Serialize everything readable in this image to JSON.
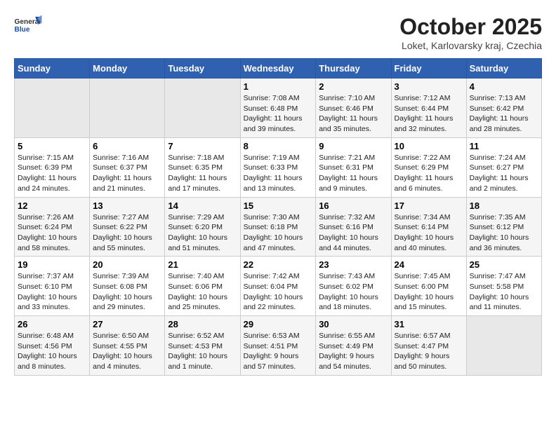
{
  "header": {
    "logo_general": "General",
    "logo_blue": "Blue",
    "title": "October 2025",
    "location": "Loket, Karlovarsky kraj, Czechia"
  },
  "weekdays": [
    "Sunday",
    "Monday",
    "Tuesday",
    "Wednesday",
    "Thursday",
    "Friday",
    "Saturday"
  ],
  "weeks": [
    [
      {
        "day": "",
        "info": ""
      },
      {
        "day": "",
        "info": ""
      },
      {
        "day": "",
        "info": ""
      },
      {
        "day": "1",
        "info": "Sunrise: 7:08 AM\nSunset: 6:48 PM\nDaylight: 11 hours and 39 minutes."
      },
      {
        "day": "2",
        "info": "Sunrise: 7:10 AM\nSunset: 6:46 PM\nDaylight: 11 hours and 35 minutes."
      },
      {
        "day": "3",
        "info": "Sunrise: 7:12 AM\nSunset: 6:44 PM\nDaylight: 11 hours and 32 minutes."
      },
      {
        "day": "4",
        "info": "Sunrise: 7:13 AM\nSunset: 6:42 PM\nDaylight: 11 hours and 28 minutes."
      }
    ],
    [
      {
        "day": "5",
        "info": "Sunrise: 7:15 AM\nSunset: 6:39 PM\nDaylight: 11 hours and 24 minutes."
      },
      {
        "day": "6",
        "info": "Sunrise: 7:16 AM\nSunset: 6:37 PM\nDaylight: 11 hours and 21 minutes."
      },
      {
        "day": "7",
        "info": "Sunrise: 7:18 AM\nSunset: 6:35 PM\nDaylight: 11 hours and 17 minutes."
      },
      {
        "day": "8",
        "info": "Sunrise: 7:19 AM\nSunset: 6:33 PM\nDaylight: 11 hours and 13 minutes."
      },
      {
        "day": "9",
        "info": "Sunrise: 7:21 AM\nSunset: 6:31 PM\nDaylight: 11 hours and 9 minutes."
      },
      {
        "day": "10",
        "info": "Sunrise: 7:22 AM\nSunset: 6:29 PM\nDaylight: 11 hours and 6 minutes."
      },
      {
        "day": "11",
        "info": "Sunrise: 7:24 AM\nSunset: 6:27 PM\nDaylight: 11 hours and 2 minutes."
      }
    ],
    [
      {
        "day": "12",
        "info": "Sunrise: 7:26 AM\nSunset: 6:24 PM\nDaylight: 10 hours and 58 minutes."
      },
      {
        "day": "13",
        "info": "Sunrise: 7:27 AM\nSunset: 6:22 PM\nDaylight: 10 hours and 55 minutes."
      },
      {
        "day": "14",
        "info": "Sunrise: 7:29 AM\nSunset: 6:20 PM\nDaylight: 10 hours and 51 minutes."
      },
      {
        "day": "15",
        "info": "Sunrise: 7:30 AM\nSunset: 6:18 PM\nDaylight: 10 hours and 47 minutes."
      },
      {
        "day": "16",
        "info": "Sunrise: 7:32 AM\nSunset: 6:16 PM\nDaylight: 10 hours and 44 minutes."
      },
      {
        "day": "17",
        "info": "Sunrise: 7:34 AM\nSunset: 6:14 PM\nDaylight: 10 hours and 40 minutes."
      },
      {
        "day": "18",
        "info": "Sunrise: 7:35 AM\nSunset: 6:12 PM\nDaylight: 10 hours and 36 minutes."
      }
    ],
    [
      {
        "day": "19",
        "info": "Sunrise: 7:37 AM\nSunset: 6:10 PM\nDaylight: 10 hours and 33 minutes."
      },
      {
        "day": "20",
        "info": "Sunrise: 7:39 AM\nSunset: 6:08 PM\nDaylight: 10 hours and 29 minutes."
      },
      {
        "day": "21",
        "info": "Sunrise: 7:40 AM\nSunset: 6:06 PM\nDaylight: 10 hours and 25 minutes."
      },
      {
        "day": "22",
        "info": "Sunrise: 7:42 AM\nSunset: 6:04 PM\nDaylight: 10 hours and 22 minutes."
      },
      {
        "day": "23",
        "info": "Sunrise: 7:43 AM\nSunset: 6:02 PM\nDaylight: 10 hours and 18 minutes."
      },
      {
        "day": "24",
        "info": "Sunrise: 7:45 AM\nSunset: 6:00 PM\nDaylight: 10 hours and 15 minutes."
      },
      {
        "day": "25",
        "info": "Sunrise: 7:47 AM\nSunset: 5:58 PM\nDaylight: 10 hours and 11 minutes."
      }
    ],
    [
      {
        "day": "26",
        "info": "Sunrise: 6:48 AM\nSunset: 4:56 PM\nDaylight: 10 hours and 8 minutes."
      },
      {
        "day": "27",
        "info": "Sunrise: 6:50 AM\nSunset: 4:55 PM\nDaylight: 10 hours and 4 minutes."
      },
      {
        "day": "28",
        "info": "Sunrise: 6:52 AM\nSunset: 4:53 PM\nDaylight: 10 hours and 1 minute."
      },
      {
        "day": "29",
        "info": "Sunrise: 6:53 AM\nSunset: 4:51 PM\nDaylight: 9 hours and 57 minutes."
      },
      {
        "day": "30",
        "info": "Sunrise: 6:55 AM\nSunset: 4:49 PM\nDaylight: 9 hours and 54 minutes."
      },
      {
        "day": "31",
        "info": "Sunrise: 6:57 AM\nSunset: 4:47 PM\nDaylight: 9 hours and 50 minutes."
      },
      {
        "day": "",
        "info": ""
      }
    ]
  ]
}
